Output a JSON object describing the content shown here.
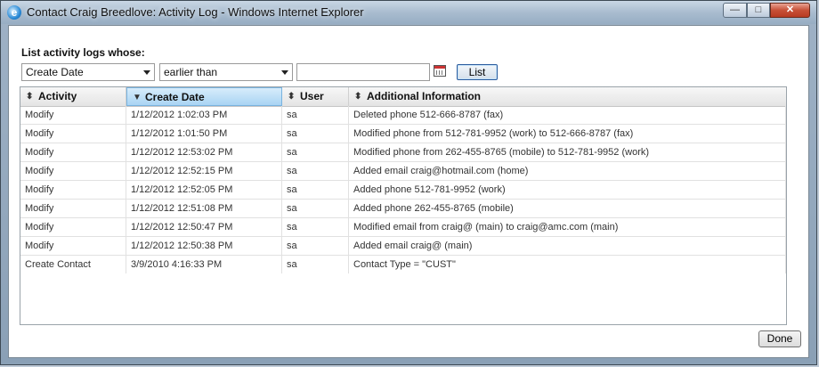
{
  "window": {
    "title": "Contact Craig Breedlove: Activity Log - Windows Internet Explorer",
    "app_icon": "e",
    "minimize_glyph": "—",
    "maximize_glyph": "□",
    "close_glyph": "✕"
  },
  "filter": {
    "prompt": "List activity logs whose:",
    "field_value": "Create Date",
    "operator_value": "earlier than",
    "date_value": "",
    "list_button": "List"
  },
  "table": {
    "columns": [
      {
        "label": "Activity",
        "sort_glyph": "⬍"
      },
      {
        "label": "Create Date",
        "sort_glyph": "▼"
      },
      {
        "label": "User",
        "sort_glyph": "⬍"
      },
      {
        "label": "Additional Information",
        "sort_glyph": "⬍"
      }
    ],
    "rows": [
      [
        "Modify",
        "1/12/2012 1:02:03 PM",
        "sa",
        "Deleted phone 512-666-8787 (fax)"
      ],
      [
        "Modify",
        "1/12/2012 1:01:50 PM",
        "sa",
        "Modified phone from 512-781-9952 (work) to 512-666-8787 (fax)"
      ],
      [
        "Modify",
        "1/12/2012 12:53:02 PM",
        "sa",
        "Modified phone from 262-455-8765 (mobile) to 512-781-9952 (work)"
      ],
      [
        "Modify",
        "1/12/2012 12:52:15 PM",
        "sa",
        "Added email craig@hotmail.com (home)"
      ],
      [
        "Modify",
        "1/12/2012 12:52:05 PM",
        "sa",
        "Added phone 512-781-9952 (work)"
      ],
      [
        "Modify",
        "1/12/2012 12:51:08 PM",
        "sa",
        "Added phone 262-455-8765 (mobile)"
      ],
      [
        "Modify",
        "1/12/2012 12:50:47 PM",
        "sa",
        "Modified email from craig@ (main) to craig@amc.com (main)"
      ],
      [
        "Modify",
        "1/12/2012 12:50:38 PM",
        "sa",
        "Added email craig@ (main)"
      ],
      [
        "Create Contact",
        "3/9/2010 4:16:33 PM",
        "sa",
        "Contact Type = \"CUST\""
      ]
    ]
  },
  "footer": {
    "done_button": "Done"
  }
}
